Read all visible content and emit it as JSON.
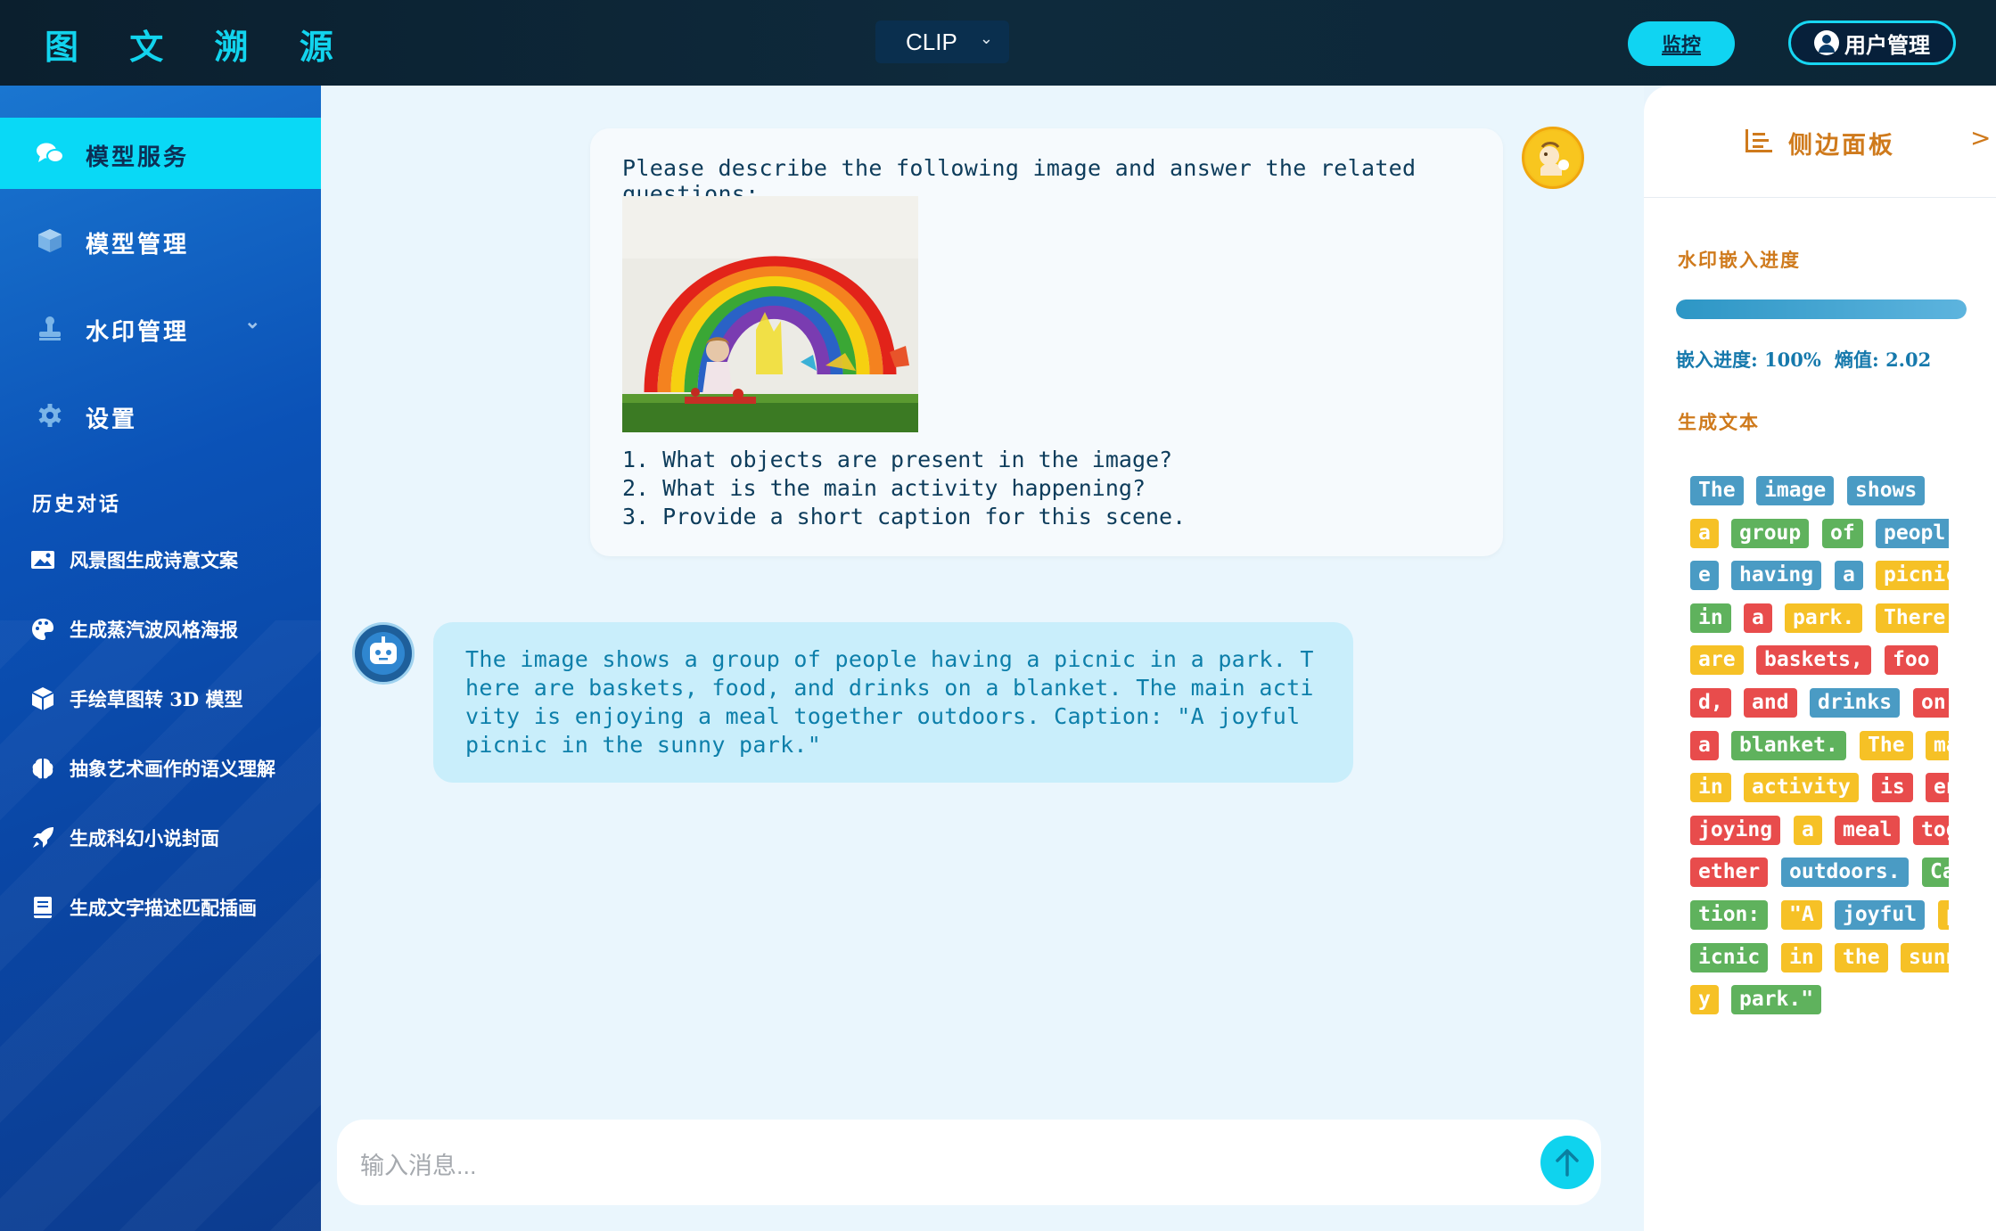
{
  "header": {
    "brand": "图 文 溯 源",
    "model_select": "CLIP",
    "monitor_label": "监控",
    "user_label": "用户管理"
  },
  "sidebar": {
    "nav": [
      {
        "label": "模型服务",
        "icon": "chat-bubbles-icon",
        "active": true
      },
      {
        "label": "模型管理",
        "icon": "cube-icon",
        "active": false
      },
      {
        "label": "水印管理",
        "icon": "stamp-icon",
        "active": false
      },
      {
        "label": "设置",
        "icon": "gear-icon",
        "active": false
      }
    ],
    "history_title": "历史对话",
    "history": [
      {
        "label": "风景图生成诗意文案",
        "icon": "image-icon"
      },
      {
        "label": "生成蒸汽波风格海报",
        "icon": "palette-icon"
      },
      {
        "label": "手绘草图转 3D 模型",
        "icon": "cube-icon"
      },
      {
        "label": "抽象艺术画作的语义理解",
        "icon": "brain-icon"
      },
      {
        "label": "生成科幻小说封面",
        "icon": "rocket-icon"
      },
      {
        "label": "生成文字描述匹配插画",
        "icon": "book-icon"
      }
    ]
  },
  "chat": {
    "user_prompt": "Please describe the following image and answer the related questions:",
    "user_questions": [
      "1. What objects are present in the image?",
      "2. What is the main activity happening?",
      "3. Provide a short caption for this scene."
    ],
    "bot_reply": "The image shows a group of people having a picnic in a park. There are baskets, food, and drinks on a blanket. The main activity is enjoying a meal together outdoors. Caption: \"A joyful picnic in the sunny park.\"",
    "input_placeholder": "输入消息..."
  },
  "panel": {
    "title": "侧边面板",
    "close": ">",
    "progress_label": "水印嵌入进度",
    "progress_value": 1.0,
    "progress_text": "嵌入进度: 100%",
    "entropy_text": "熵值: 2.02",
    "generated_label": "生成文本",
    "tokens": [
      [
        "The",
        "image",
        "shows"
      ],
      [
        "a",
        "group",
        "of",
        "peopl"
      ],
      [
        "e",
        "having",
        "a",
        "picnic"
      ],
      [
        "in",
        "a",
        "park.",
        "There"
      ],
      [
        "are",
        "baskets,",
        "foo"
      ],
      [
        "d,",
        "and",
        "drinks",
        "on"
      ],
      [
        "a",
        "blanket.",
        "The",
        "ma"
      ],
      [
        "in",
        "activity",
        "is",
        "en"
      ],
      [
        "joying",
        "a",
        "meal",
        "tog"
      ],
      [
        "ether",
        "outdoors.",
        "Cap"
      ],
      [
        "tion:",
        "\"A",
        "joyful",
        "p"
      ],
      [
        "icnic",
        "in",
        "the",
        "sunn"
      ],
      [
        "y",
        "park.\""
      ]
    ],
    "token_colors": [
      [
        0,
        0,
        0
      ],
      [
        1,
        2,
        2,
        0
      ],
      [
        0,
        0,
        0,
        1
      ],
      [
        2,
        3,
        1,
        1
      ],
      [
        1,
        3,
        3
      ],
      [
        3,
        3,
        0,
        3
      ],
      [
        3,
        2,
        1,
        1
      ],
      [
        1,
        1,
        3,
        3
      ],
      [
        3,
        1,
        3,
        3
      ],
      [
        3,
        0,
        2
      ],
      [
        2,
        1,
        0,
        1
      ],
      [
        2,
        1,
        1,
        1
      ],
      [
        1,
        2
      ]
    ]
  }
}
